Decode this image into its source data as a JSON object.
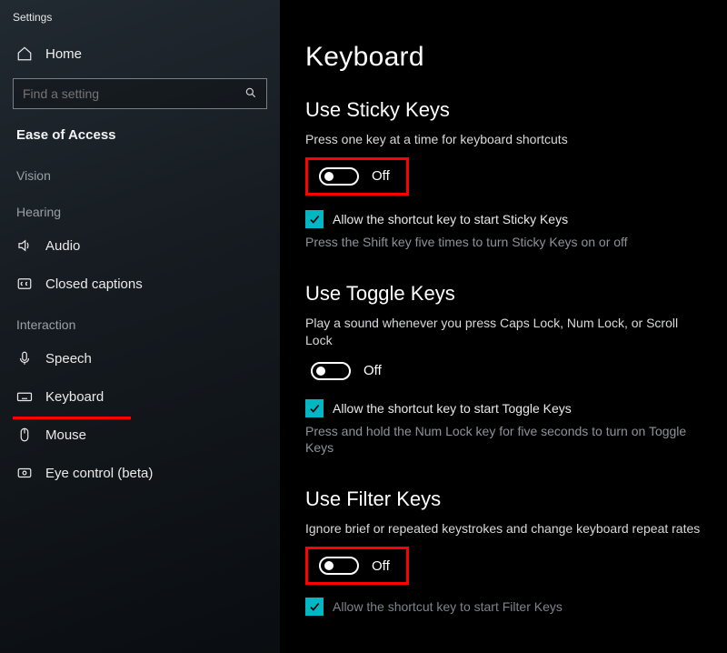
{
  "window": {
    "title": "Settings"
  },
  "sidebar": {
    "home": "Home",
    "search_placeholder": "Find a setting",
    "section": "Ease of Access",
    "groups": {
      "vision": "Vision",
      "hearing": "Hearing",
      "interaction": "Interaction"
    },
    "items": {
      "audio": "Audio",
      "closed_captions": "Closed captions",
      "speech": "Speech",
      "keyboard": "Keyboard",
      "mouse": "Mouse",
      "eye_control": "Eye control (beta)"
    }
  },
  "page": {
    "title": "Keyboard",
    "sticky": {
      "heading": "Use Sticky Keys",
      "desc": "Press one key at a time for keyboard shortcuts",
      "toggle_state": "Off",
      "shortcut_label": "Allow the shortcut key to start Sticky Keys",
      "shortcut_hint": "Press the Shift key five times to turn Sticky Keys on or off"
    },
    "togglekeys": {
      "heading": "Use Toggle Keys",
      "desc": "Play a sound whenever you press Caps Lock, Num Lock, or Scroll Lock",
      "toggle_state": "Off",
      "shortcut_label": "Allow the shortcut key to start Toggle Keys",
      "shortcut_hint": "Press and hold the Num Lock key for five seconds to turn on Toggle Keys"
    },
    "filter": {
      "heading": "Use Filter Keys",
      "desc": "Ignore brief or repeated keystrokes and change keyboard repeat rates",
      "toggle_state": "Off",
      "shortcut_label_cut": "Allow the shortcut key to start Filter Keys"
    }
  },
  "colors": {
    "accent": "#00b7c3",
    "highlight": "#ff0000"
  }
}
